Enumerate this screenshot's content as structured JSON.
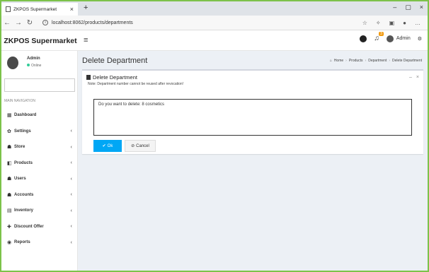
{
  "browser": {
    "tab_title": "ZKPOS Supermarket",
    "tab_close": "×",
    "new_tab": "+",
    "url": "localhost:8062/products/departments",
    "win_min": "–",
    "win_max": "▢",
    "win_close": "×"
  },
  "header": {
    "brand": "ZKPOS Supermarket",
    "menu_icon": "≡",
    "notif_count": "3",
    "user": "Admin"
  },
  "sidebar": {
    "user_name": "Admin",
    "user_status": "Online",
    "nav_header": "MAIN NAVIGATION",
    "items": [
      {
        "label": "Dashboard",
        "icon": "▦",
        "caret": ""
      },
      {
        "label": "Settings",
        "icon": "✿",
        "caret": "‹"
      },
      {
        "label": "Store",
        "icon": "☗",
        "caret": "‹"
      },
      {
        "label": "Products",
        "icon": "◧",
        "caret": "‹"
      },
      {
        "label": "Users",
        "icon": "☗",
        "caret": "‹"
      },
      {
        "label": "Accounts",
        "icon": "☗",
        "caret": "‹"
      },
      {
        "label": "Inventory",
        "icon": "▤",
        "caret": "‹"
      },
      {
        "label": "Discount Offer",
        "icon": "✚",
        "caret": "‹"
      },
      {
        "label": "Reports",
        "icon": "◉",
        "caret": "‹"
      }
    ]
  },
  "content": {
    "page_title": "Delete Department",
    "breadcrumb": [
      "Home",
      "Products",
      "Department",
      "Delete Department"
    ],
    "box_title": "Delete Department",
    "box_note": "Note: Department number cannot be reused after revocation!",
    "confirm_text": "Do you want to delete: 8 cosmetics",
    "ok_label": "Ok",
    "cancel_label": "Cancel"
  }
}
